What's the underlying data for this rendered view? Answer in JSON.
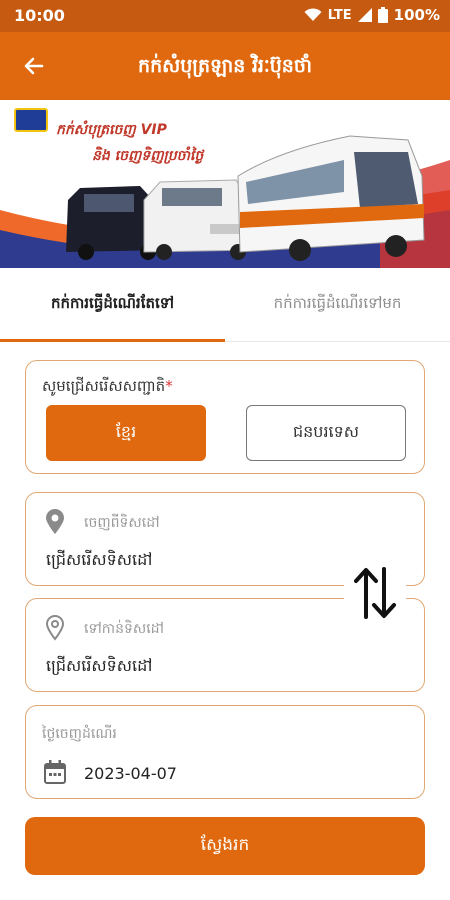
{
  "status_bar": {
    "time": "10:00",
    "network": "LTE",
    "battery": "100%",
    "icons": [
      "wifi-icon",
      "signal-icon",
      "battery-icon"
    ]
  },
  "app_bar": {
    "title": "កក់សំបុត្រឡាន វិរៈប៊ុនថាំ",
    "back_icon": "arrow-left-icon"
  },
  "banner": {
    "line1": "កក់សំបុត្រចេញ VIP",
    "line2": "និង ចេញទិញប្រចាំថ្ងៃ"
  },
  "tabs": [
    {
      "label": "កក់ការធ្វើដំណើរតែទៅ",
      "active": true
    },
    {
      "label": "កក់ការធ្វើដំណើរទៅមក",
      "active": false
    }
  ],
  "nationality": {
    "label": "សូមជ្រើសរើសសញ្ជាតិ",
    "required_mark": "*",
    "options": [
      "ខ្មែរ",
      "ជនបរទេស"
    ],
    "selected": "ខ្មែរ"
  },
  "from": {
    "hint": "ចេញពីទិសដៅ",
    "value": "ជ្រើសរើសទិសដៅ",
    "icon": "location-pin-icon"
  },
  "to": {
    "hint": "ទៅកាន់ទិសដៅ",
    "value": "ជ្រើសរើសទិសដៅ",
    "icon": "location-pin-icon"
  },
  "swap_icon": "swap-vertical-icon",
  "departure": {
    "hint": "ថ្ងៃចេញដំណើរ",
    "value": "2023-04-07",
    "icon": "calendar-icon"
  },
  "search_button": "ស្វែងរក",
  "colors": {
    "primary": "#e0690f",
    "status_bar": "#c65a10",
    "card_border": "#e0a875"
  }
}
